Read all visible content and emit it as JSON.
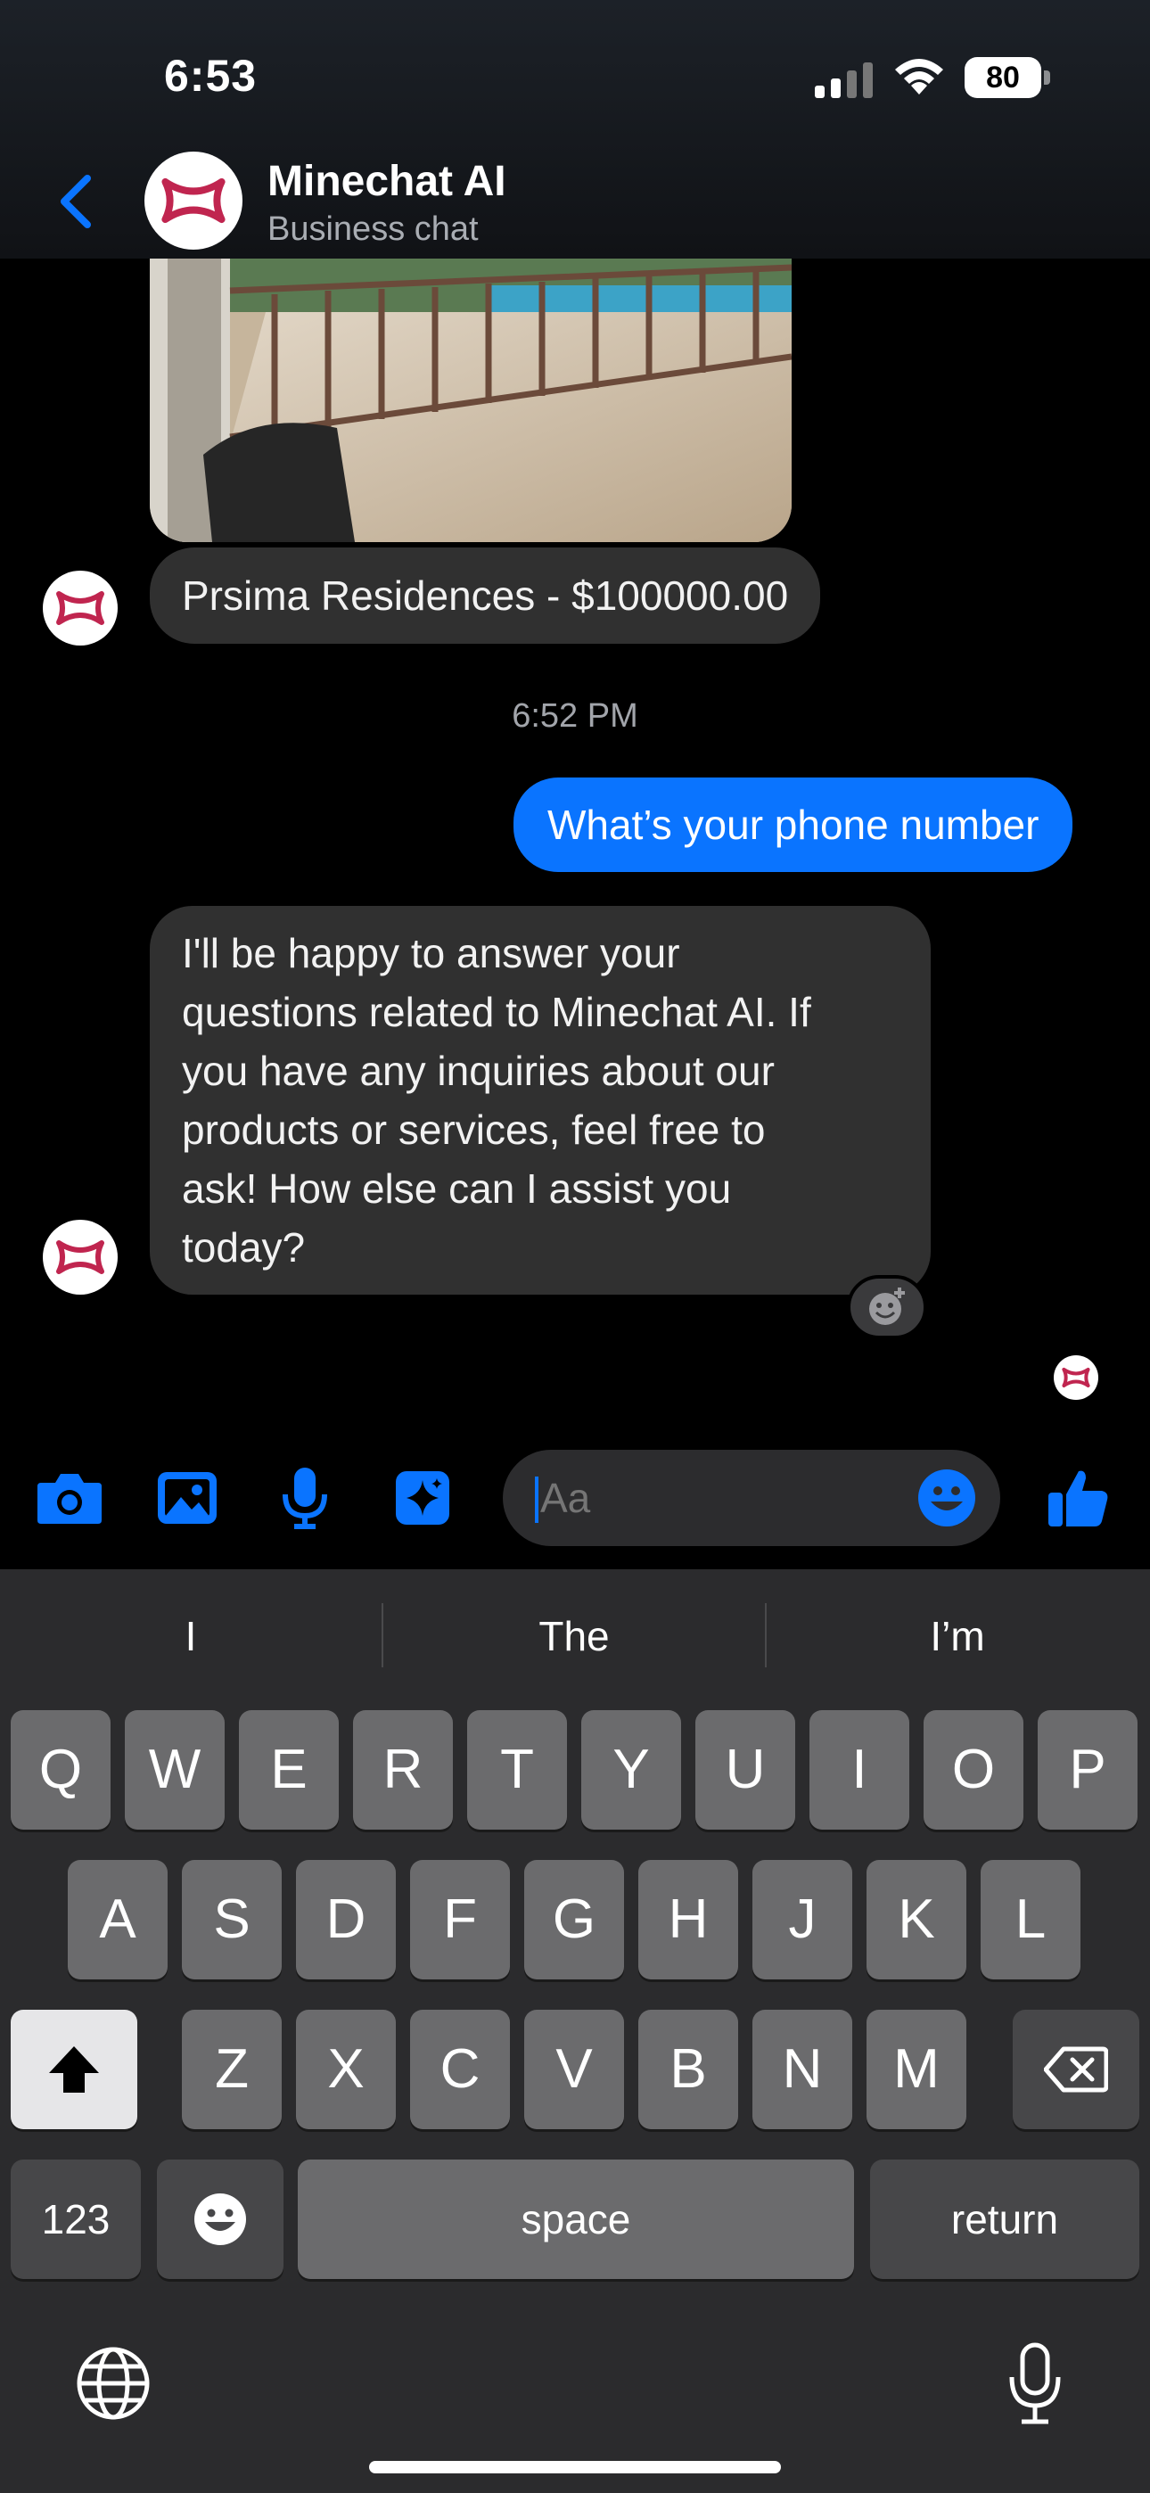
{
  "status_bar": {
    "time": "6:53",
    "battery": "80"
  },
  "header": {
    "contact_name": "Minechat AI",
    "subtitle": "Business chat"
  },
  "messages": {
    "listing_caption": "Prsima Residences - $100000.00",
    "timestamp": "6:52 PM",
    "outgoing_1": "What’s your phone number",
    "incoming_reply_lines": [
      "I'll be happy to answer your",
      "questions related to Minechat AI. If",
      "you have any inquiries about our",
      "products or services, feel free to",
      "ask! How else can I assist you",
      "today?"
    ]
  },
  "composer": {
    "placeholder": "Aa"
  },
  "keyboard": {
    "suggestions": [
      "I",
      "The",
      "I’m"
    ],
    "row1": [
      "Q",
      "W",
      "E",
      "R",
      "T",
      "Y",
      "U",
      "I",
      "O",
      "P"
    ],
    "row2": [
      "A",
      "S",
      "D",
      "F",
      "G",
      "H",
      "J",
      "K",
      "L"
    ],
    "row3": [
      "Z",
      "X",
      "C",
      "V",
      "B",
      "N",
      "M"
    ],
    "numbers_key": "123",
    "space_key": "space",
    "return_key": "return"
  },
  "colors": {
    "accent": "#0a74ff",
    "incoming_bubble": "#303030",
    "brand_logo": "#c0254f"
  },
  "icons": [
    "back-chevron-icon",
    "camera-icon",
    "gallery-icon",
    "mic-icon",
    "sparkle-icon",
    "emoji-icon",
    "thumbs-up-icon",
    "globe-icon",
    "dictation-mic-icon",
    "shift-icon",
    "backspace-icon"
  ]
}
